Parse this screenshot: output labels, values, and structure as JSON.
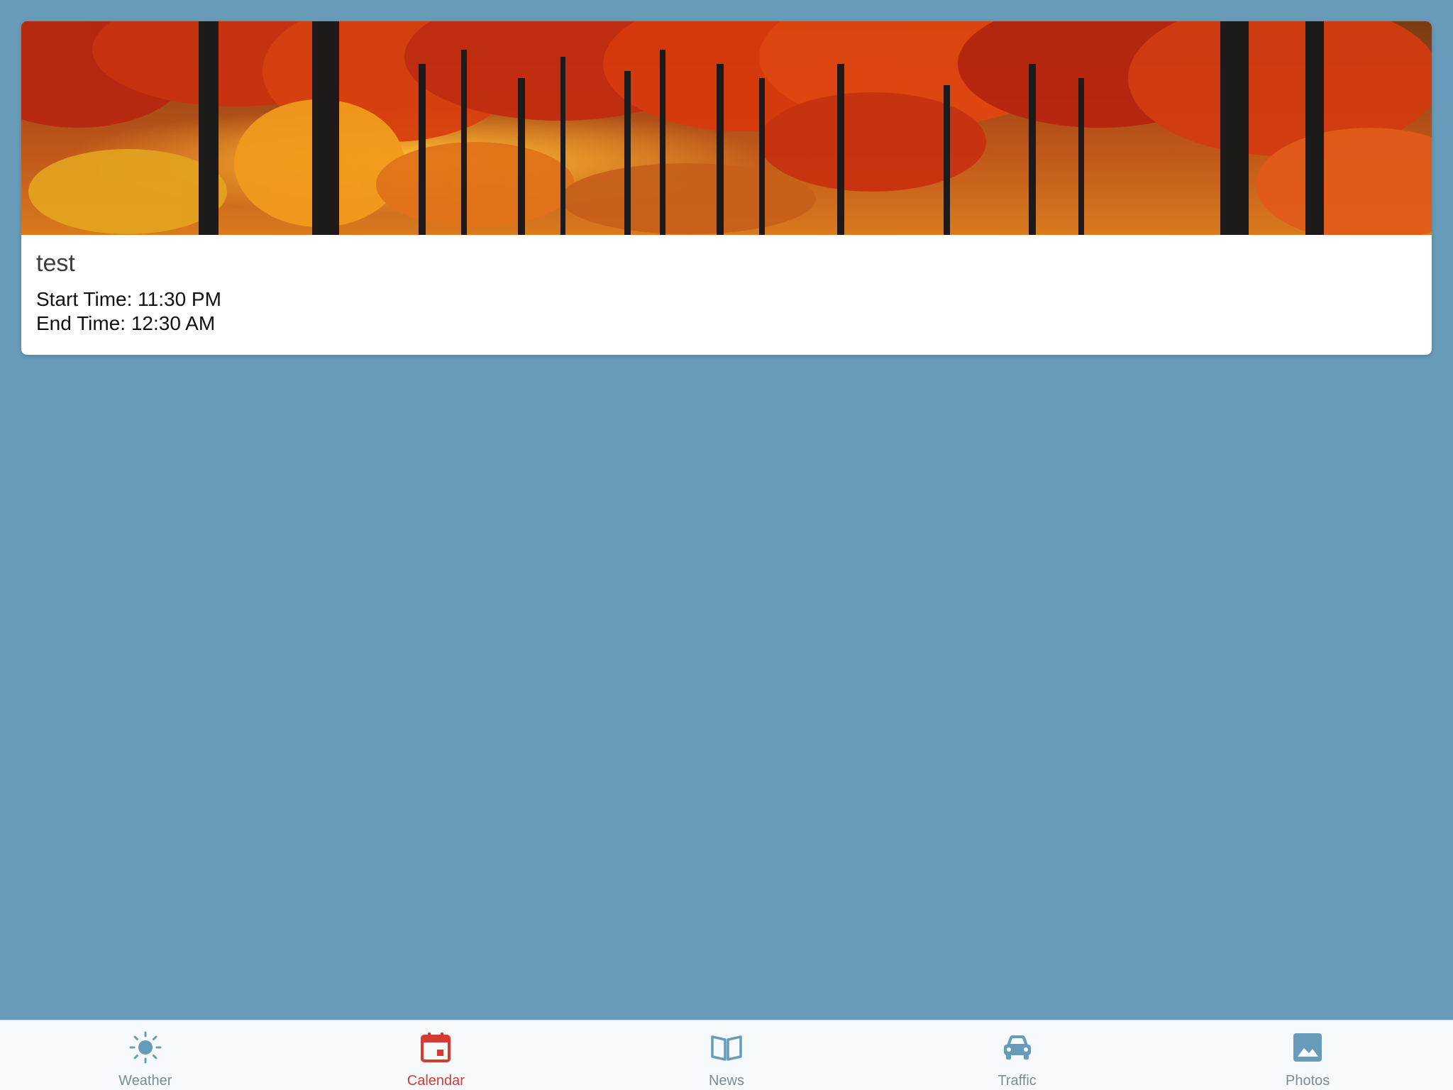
{
  "event": {
    "title": "test",
    "start_time": "Start Time: 11:30 PM",
    "end_time": "End Time: 12:30 AM",
    "banner_image": "autumn-forest"
  },
  "tabs": [
    {
      "label": "Weather",
      "icon": "sun-icon",
      "active": false
    },
    {
      "label": "Calendar",
      "icon": "calendar-icon",
      "active": true
    },
    {
      "label": "News",
      "icon": "book-icon",
      "active": false
    },
    {
      "label": "Traffic",
      "icon": "car-icon",
      "active": false
    },
    {
      "label": "Photos",
      "icon": "image-icon",
      "active": false
    }
  ],
  "colors": {
    "background": "#689bb9",
    "active_tab": "#d63b2f",
    "inactive_icon": "#689bb9",
    "inactive_label": "#7b8b95"
  }
}
